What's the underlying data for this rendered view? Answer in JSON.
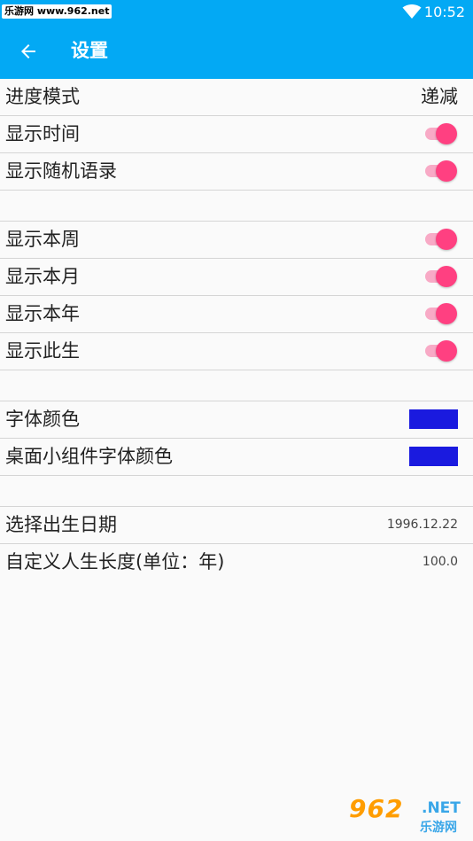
{
  "status_bar": {
    "watermark": "乐游网 www.962.net",
    "time": "10:52"
  },
  "header": {
    "title": "设置"
  },
  "settings": {
    "progress_mode": {
      "label": "进度模式",
      "value": "递减"
    },
    "show_time": {
      "label": "显示时间",
      "enabled": true
    },
    "show_quotes": {
      "label": "显示随机语录",
      "enabled": true
    },
    "show_week": {
      "label": "显示本周",
      "enabled": true
    },
    "show_month": {
      "label": "显示本月",
      "enabled": true
    },
    "show_year": {
      "label": "显示本年",
      "enabled": true
    },
    "show_life": {
      "label": "显示此生",
      "enabled": true
    },
    "font_color": {
      "label": "字体颜色",
      "color": "#1a1adf"
    },
    "widget_font_color": {
      "label": "桌面小组件字体颜色",
      "color": "#1a1adf"
    },
    "birth_date": {
      "label": "选择出生日期",
      "value": "1996.12.22"
    },
    "life_length": {
      "label": "自定义人生长度(单位：年)",
      "value": "100.0"
    }
  },
  "colors": {
    "app_bar": "#03a9f4",
    "switch_thumb": "#ff4081",
    "switch_track": "#f8aac6"
  },
  "watermark_logo": {
    "big": "962",
    "net": ".NET",
    "sub": "乐游网"
  }
}
